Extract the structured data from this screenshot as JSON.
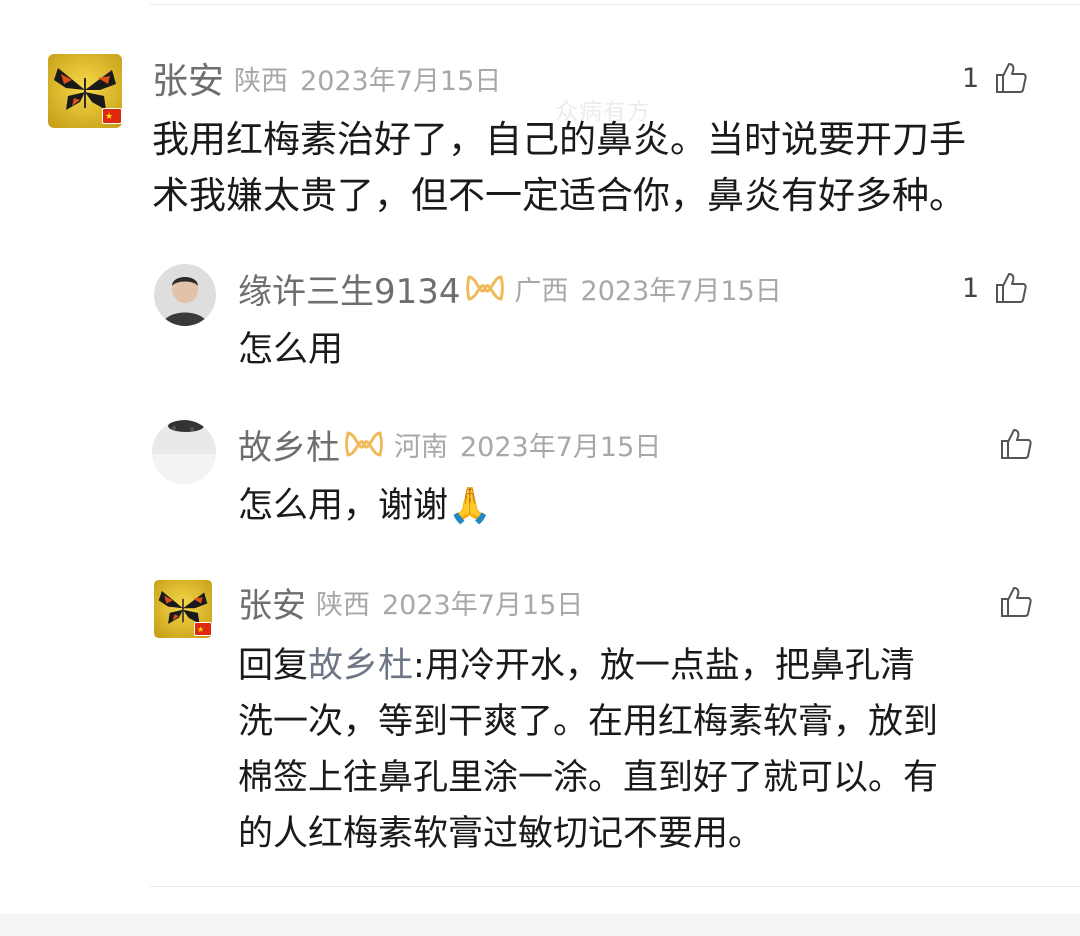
{
  "watermark": "众病有方",
  "comments": [
    {
      "username": "张安",
      "region": "陕西",
      "date": "2023年7月15日",
      "likes": "1",
      "lines": [
        "我用红梅素治好了，自己的鼻炎。当时说要开刀手",
        "术我嫌太贵了，但不一定适合你，鼻炎有好多种。"
      ]
    },
    {
      "username": "缘许三生9134",
      "region": "广西",
      "date": "2023年7月15日",
      "likes": "1",
      "lines": [
        "怎么用"
      ]
    },
    {
      "username": "故乡杜",
      "region": "河南",
      "date": "2023年7月15日",
      "likes": "",
      "lines": [
        "怎么用，谢谢🙏"
      ]
    },
    {
      "username": "张安",
      "region": "陕西",
      "date": "2023年7月15日",
      "likes": "",
      "reply_prefix": "回复",
      "reply_to": "故乡杜",
      "reply_first": ":用冷开水，放一点盐，把鼻孔清",
      "lines": [
        "洗一次，等到干爽了。在用红梅素软膏，放到",
        "棉签上往鼻孔里涂一涂。直到好了就可以。有",
        "的人红梅素软膏过敏切记不要用。"
      ]
    }
  ]
}
